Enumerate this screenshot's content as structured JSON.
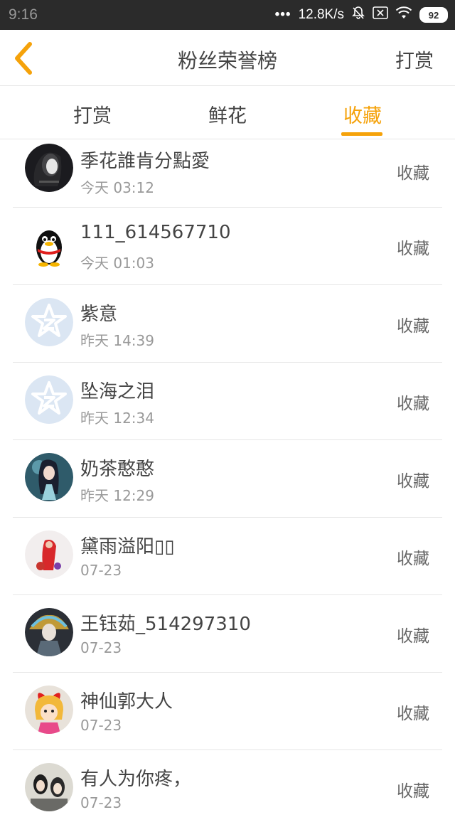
{
  "status_bar": {
    "time": "9:16",
    "dots": "•••",
    "speed": "12.8K/s",
    "battery": "92"
  },
  "header": {
    "title": "粉丝荣誉榜",
    "action": "打赏",
    "back_icon": "chevron-left-icon",
    "accent": "#f5a20a"
  },
  "tabs": [
    {
      "label": "打赏"
    },
    {
      "label": "鲜花"
    },
    {
      "label": "收藏",
      "active": true
    }
  ],
  "fans": [
    {
      "name": "季花誰肯分點愛",
      "time": "今天 03:12",
      "badge": "收藏",
      "avatar": "dark-portrait"
    },
    {
      "name": "111_614567710",
      "time": "今天 01:03",
      "badge": "收藏",
      "avatar": "qq-penguin"
    },
    {
      "name": "紫意",
      "time": "昨天 14:39",
      "badge": "收藏",
      "avatar": "default-star"
    },
    {
      "name": "坠海之泪",
      "time": "昨天 12:34",
      "badge": "收藏",
      "avatar": "default-star"
    },
    {
      "name": "奶茶憨憨",
      "time": "昨天 12:29",
      "badge": "收藏",
      "avatar": "anime-teal"
    },
    {
      "name": "黛雨溢阳▯▯",
      "time": "07-23",
      "badge": "收藏",
      "avatar": "red-figure"
    },
    {
      "name": "王钰茹_514297310",
      "time": "07-23",
      "badge": "收藏",
      "avatar": "anime-dark"
    },
    {
      "name": "神仙郭大人",
      "time": "07-23",
      "badge": "收藏",
      "avatar": "cartoon-girl"
    },
    {
      "name": "有人为你疼，",
      "time": "07-23",
      "badge": "收藏",
      "avatar": "photo-couple"
    }
  ]
}
